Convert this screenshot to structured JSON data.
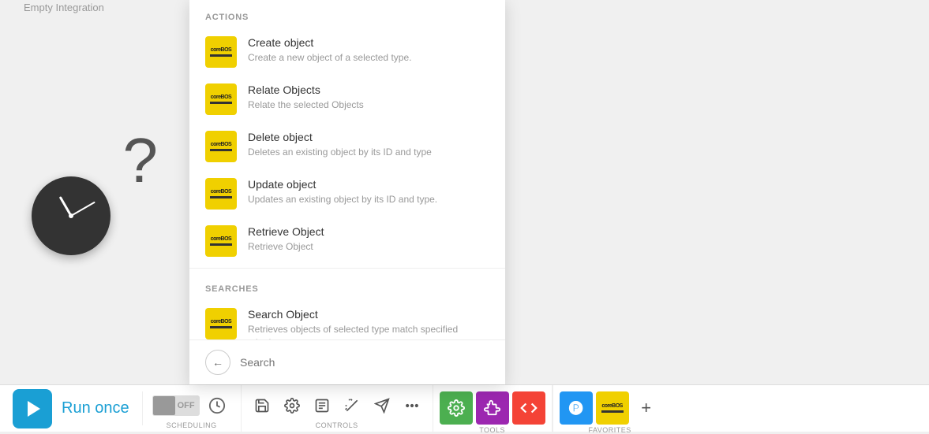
{
  "header": {
    "empty_integration": "Empty Integration"
  },
  "left_panel": {
    "alt": "Clock with question mark"
  },
  "dropdown": {
    "actions_label": "ACTIONS",
    "searches_label": "SEARCHES",
    "search_placeholder": "Search",
    "actions": [
      {
        "id": "create-object",
        "title": "Create object",
        "description": "Create a new object of a selected type.",
        "icon_label": "coreBOS"
      },
      {
        "id": "relate-objects",
        "title": "Relate Objects",
        "description": "Relate the selected Objects",
        "icon_label": "coreBOS"
      },
      {
        "id": "delete-object",
        "title": "Delete object",
        "description": "Deletes an existing object by its ID and type",
        "icon_label": "coreBOS"
      },
      {
        "id": "update-object",
        "title": "Update object",
        "description": "Updates an existing object by its ID and type.",
        "icon_label": "coreBOS"
      },
      {
        "id": "retrieve-object",
        "title": "Retrieve Object",
        "description": "Retrieve Object",
        "icon_label": "coreBOS"
      }
    ],
    "searches": [
      {
        "id": "search-object",
        "title": "Search Object",
        "description": "Retrieves objects of selected type match specified criteria.",
        "icon_label": "coreBOS"
      }
    ]
  },
  "toolbar": {
    "run_once_label": "Run once",
    "scheduling_label": "SCHEDULING",
    "controls_label": "CONTROLS",
    "tools_label": "TOOLS",
    "favorites_label": "FAVORITES",
    "toggle_state": "OFF",
    "add_label": "+"
  }
}
